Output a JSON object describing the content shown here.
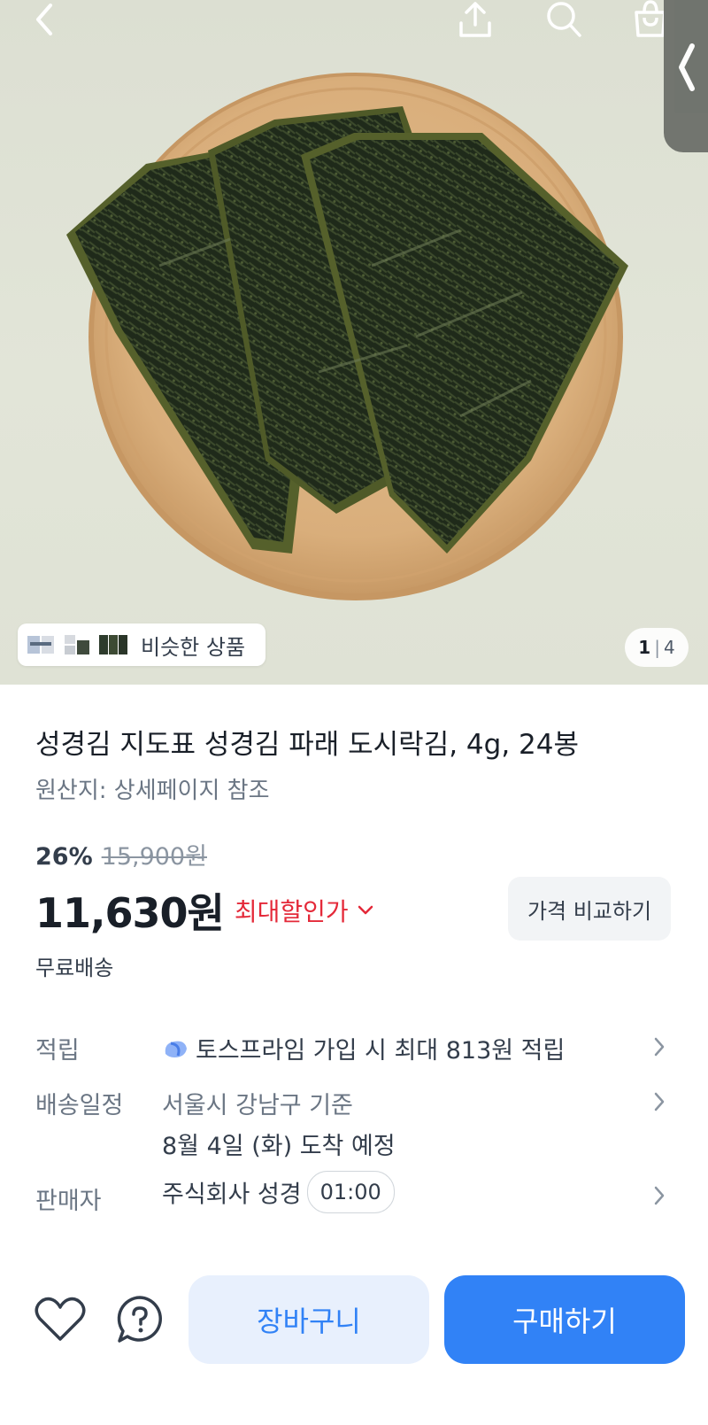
{
  "hero": {
    "similar_label": "비슷한 상품",
    "image_index": "1",
    "image_total": "4"
  },
  "product": {
    "title": "성경김 지도표 성경김 파래 도시락김, 4g, 24봉",
    "origin": "원산지: 상세페이지 참조",
    "discount_rate": "26%",
    "original_price": "15,900원",
    "price": "11,630원",
    "max_discount_label": "최대할인가",
    "compare_button": "가격 비교하기",
    "shipping": "무료배송"
  },
  "info": {
    "points_label": "적립",
    "points_value": "토스프라임 가입 시 최대 813원 적립",
    "delivery_label": "배송일정",
    "delivery_location": "서울시 강남구 기준",
    "delivery_eta": "8월 4일 (화) 도착 예정",
    "seller_label": "판매자",
    "seller_name": "주식회사 성경",
    "seller_time": "01:00"
  },
  "actions": {
    "cart_button": "장바구니",
    "buy_button": "구매하기"
  },
  "icons": {
    "back": "back-arrow-icon",
    "share": "share-icon",
    "search": "search-icon",
    "cart": "shopping-bag-icon",
    "wishlist": "heart-icon",
    "inquiry": "question-icon",
    "points": "toss-prime-icon"
  },
  "colors": {
    "accent": "#3182f6",
    "discount_red": "#e42939",
    "cart_bg": "#e8f0fd"
  }
}
